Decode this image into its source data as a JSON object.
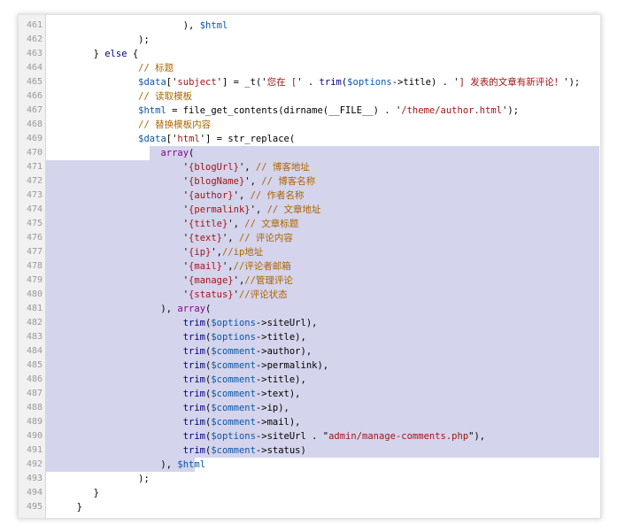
{
  "editor": {
    "highlight_color": "#d4d4ec",
    "lines": [
      {
        "n": "461",
        "parts": [
          {
            "t": "        ), ",
            "c": "p"
          },
          {
            "t": "$html",
            "c": "var"
          }
        ]
      },
      {
        "n": "462",
        "parts": [
          {
            "t": "    );",
            "c": "p"
          }
        ]
      },
      {
        "n": "463",
        "parts": [
          {
            "t": "} ",
            "c": "p"
          },
          {
            "t": "else",
            "c": "kw"
          },
          {
            "t": " {",
            "c": "p"
          }
        ]
      },
      {
        "n": "464",
        "parts": [
          {
            "t": "    // 标题",
            "c": "cmt"
          }
        ]
      },
      {
        "n": "465",
        "parts": [
          {
            "t": "    ",
            "c": "p"
          },
          {
            "t": "$data",
            "c": "var"
          },
          {
            "t": "['",
            "c": "p"
          },
          {
            "t": "subject",
            "c": "str"
          },
          {
            "t": "'] = _t('",
            "c": "p"
          },
          {
            "t": "您在 [",
            "c": "str"
          },
          {
            "t": "' . ",
            "c": "p"
          },
          {
            "t": "trim",
            "c": "fn"
          },
          {
            "t": "(",
            "c": "p"
          },
          {
            "t": "$options",
            "c": "var"
          },
          {
            "t": "->title) . '",
            "c": "p"
          },
          {
            "t": "] 发表的文章有新评论！",
            "c": "str"
          },
          {
            "t": "');",
            "c": "p"
          }
        ]
      },
      {
        "n": "466",
        "parts": [
          {
            "t": "    // 读取模板",
            "c": "cmt"
          }
        ]
      },
      {
        "n": "467",
        "parts": [
          {
            "t": "    ",
            "c": "p"
          },
          {
            "t": "$html",
            "c": "var"
          },
          {
            "t": " = file_get_contents(dirname(__FILE__) . '",
            "c": "p"
          },
          {
            "t": "/theme/author.html",
            "c": "str"
          },
          {
            "t": "');",
            "c": "p"
          }
        ]
      },
      {
        "n": "468",
        "parts": [
          {
            "t": "    // 替换模板内容",
            "c": "cmt"
          }
        ]
      },
      {
        "n": "469",
        "parts": [
          {
            "t": "    ",
            "c": "p"
          },
          {
            "t": "$data",
            "c": "var"
          },
          {
            "t": "['",
            "c": "p"
          },
          {
            "t": "html",
            "c": "str"
          },
          {
            "t": "'] = str_replace(",
            "c": "p"
          }
        ]
      },
      {
        "n": "470",
        "hl": "partial",
        "parts": [
          {
            "t": "        ",
            "c": "p"
          },
          {
            "t": "array",
            "c": "arr"
          },
          {
            "t": "(",
            "c": "p"
          }
        ]
      },
      {
        "n": "471",
        "hl": "full",
        "parts": [
          {
            "t": "            '",
            "c": "p"
          },
          {
            "t": "{blogUrl}",
            "c": "str"
          },
          {
            "t": "', ",
            "c": "p"
          },
          {
            "t": "// 博客地址",
            "c": "cmt"
          }
        ]
      },
      {
        "n": "472",
        "hl": "full",
        "parts": [
          {
            "t": "            '",
            "c": "p"
          },
          {
            "t": "{blogName}",
            "c": "str"
          },
          {
            "t": "', ",
            "c": "p"
          },
          {
            "t": "// 博客名称",
            "c": "cmt"
          }
        ]
      },
      {
        "n": "473",
        "hl": "full",
        "parts": [
          {
            "t": "            '",
            "c": "p"
          },
          {
            "t": "{author}",
            "c": "str"
          },
          {
            "t": "', ",
            "c": "p"
          },
          {
            "t": "// 作者名称",
            "c": "cmt"
          }
        ]
      },
      {
        "n": "474",
        "hl": "full",
        "parts": [
          {
            "t": "            '",
            "c": "p"
          },
          {
            "t": "{permalink}",
            "c": "str"
          },
          {
            "t": "', ",
            "c": "p"
          },
          {
            "t": "// 文章地址",
            "c": "cmt"
          }
        ]
      },
      {
        "n": "475",
        "hl": "full",
        "parts": [
          {
            "t": "            '",
            "c": "p"
          },
          {
            "t": "{title}",
            "c": "str"
          },
          {
            "t": "', ",
            "c": "p"
          },
          {
            "t": "// 文章标题",
            "c": "cmt"
          }
        ]
      },
      {
        "n": "476",
        "hl": "full",
        "parts": [
          {
            "t": "            '",
            "c": "p"
          },
          {
            "t": "{text}",
            "c": "str"
          },
          {
            "t": "', ",
            "c": "p"
          },
          {
            "t": "// 评论内容",
            "c": "cmt"
          }
        ]
      },
      {
        "n": "477",
        "hl": "full",
        "parts": [
          {
            "t": "            '",
            "c": "p"
          },
          {
            "t": "{ip}",
            "c": "str"
          },
          {
            "t": "',",
            "c": "p"
          },
          {
            "t": "//ip地址",
            "c": "cmt"
          }
        ]
      },
      {
        "n": "478",
        "hl": "full",
        "parts": [
          {
            "t": "            '",
            "c": "p"
          },
          {
            "t": "{mail}",
            "c": "str"
          },
          {
            "t": "',",
            "c": "p"
          },
          {
            "t": "//评论者邮箱",
            "c": "cmt"
          }
        ]
      },
      {
        "n": "479",
        "hl": "full",
        "parts": [
          {
            "t": "            '",
            "c": "p"
          },
          {
            "t": "{manage}",
            "c": "str"
          },
          {
            "t": "',",
            "c": "p"
          },
          {
            "t": "//管理评论",
            "c": "cmt"
          }
        ]
      },
      {
        "n": "480",
        "hl": "full",
        "parts": [
          {
            "t": "            '",
            "c": "p"
          },
          {
            "t": "{status}",
            "c": "str"
          },
          {
            "t": "'",
            "c": "p"
          },
          {
            "t": "//评论状态",
            "c": "cmt"
          }
        ]
      },
      {
        "n": "481",
        "hl": "full",
        "parts": [
          {
            "t": "        ), ",
            "c": "p"
          },
          {
            "t": "array",
            "c": "arr"
          },
          {
            "t": "(",
            "c": "p"
          }
        ]
      },
      {
        "n": "482",
        "hl": "full",
        "parts": [
          {
            "t": "            ",
            "c": "p"
          },
          {
            "t": "trim",
            "c": "fn"
          },
          {
            "t": "(",
            "c": "p"
          },
          {
            "t": "$options",
            "c": "var"
          },
          {
            "t": "->siteUrl),",
            "c": "p"
          }
        ]
      },
      {
        "n": "483",
        "hl": "full",
        "parts": [
          {
            "t": "            ",
            "c": "p"
          },
          {
            "t": "trim",
            "c": "fn"
          },
          {
            "t": "(",
            "c": "p"
          },
          {
            "t": "$options",
            "c": "var"
          },
          {
            "t": "->title),",
            "c": "p"
          }
        ]
      },
      {
        "n": "484",
        "hl": "full",
        "parts": [
          {
            "t": "            ",
            "c": "p"
          },
          {
            "t": "trim",
            "c": "fn"
          },
          {
            "t": "(",
            "c": "p"
          },
          {
            "t": "$comment",
            "c": "var"
          },
          {
            "t": "->author),",
            "c": "p"
          }
        ]
      },
      {
        "n": "485",
        "hl": "full",
        "parts": [
          {
            "t": "            ",
            "c": "p"
          },
          {
            "t": "trim",
            "c": "fn"
          },
          {
            "t": "(",
            "c": "p"
          },
          {
            "t": "$comment",
            "c": "var"
          },
          {
            "t": "->permalink),",
            "c": "p"
          }
        ]
      },
      {
        "n": "486",
        "hl": "full",
        "parts": [
          {
            "t": "            ",
            "c": "p"
          },
          {
            "t": "trim",
            "c": "fn"
          },
          {
            "t": "(",
            "c": "p"
          },
          {
            "t": "$comment",
            "c": "var"
          },
          {
            "t": "->title),",
            "c": "p"
          }
        ]
      },
      {
        "n": "487",
        "hl": "full",
        "parts": [
          {
            "t": "            ",
            "c": "p"
          },
          {
            "t": "trim",
            "c": "fn"
          },
          {
            "t": "(",
            "c": "p"
          },
          {
            "t": "$comment",
            "c": "var"
          },
          {
            "t": "->text),",
            "c": "p"
          }
        ]
      },
      {
        "n": "488",
        "hl": "full",
        "parts": [
          {
            "t": "            ",
            "c": "p"
          },
          {
            "t": "trim",
            "c": "fn"
          },
          {
            "t": "(",
            "c": "p"
          },
          {
            "t": "$comment",
            "c": "var"
          },
          {
            "t": "->ip),",
            "c": "p"
          }
        ]
      },
      {
        "n": "489",
        "hl": "full",
        "parts": [
          {
            "t": "            ",
            "c": "p"
          },
          {
            "t": "trim",
            "c": "fn"
          },
          {
            "t": "(",
            "c": "p"
          },
          {
            "t": "$comment",
            "c": "var"
          },
          {
            "t": "->mail),",
            "c": "p"
          }
        ]
      },
      {
        "n": "490",
        "hl": "full",
        "parts": [
          {
            "t": "            ",
            "c": "p"
          },
          {
            "t": "trim",
            "c": "fn"
          },
          {
            "t": "(",
            "c": "p"
          },
          {
            "t": "$options",
            "c": "var"
          },
          {
            "t": "->siteUrl . \"",
            "c": "p"
          },
          {
            "t": "admin/manage-comments.php",
            "c": "str"
          },
          {
            "t": "\"),",
            "c": "p"
          }
        ]
      },
      {
        "n": "491",
        "hl": "full",
        "parts": [
          {
            "t": "            ",
            "c": "p"
          },
          {
            "t": "trim",
            "c": "fn"
          },
          {
            "t": "(",
            "c": "p"
          },
          {
            "t": "$comment",
            "c": "var"
          },
          {
            "t": "->status)",
            "c": "p"
          }
        ]
      },
      {
        "n": "492",
        "hl": "end",
        "parts": [
          {
            "t": "        ), ",
            "c": "p"
          },
          {
            "t": "$html",
            "c": "var"
          }
        ]
      },
      {
        "n": "493",
        "parts": [
          {
            "t": "    );",
            "c": "p"
          }
        ]
      },
      {
        "n": "494",
        "parts": [
          {
            "t": "}",
            "c": "p"
          }
        ]
      },
      {
        "n": "495",
        "parts": [
          {
            "t": "}",
            "c": "p"
          }
        ]
      }
    ]
  }
}
